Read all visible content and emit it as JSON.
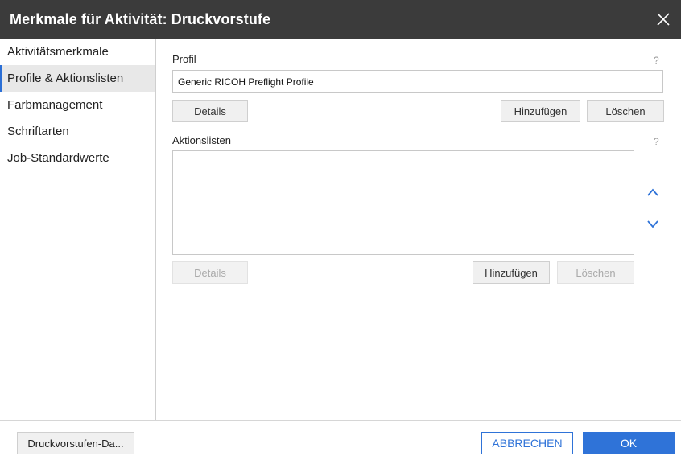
{
  "dialog": {
    "title": "Merkmale für Aktivität: Druckvorstufe"
  },
  "sidebar": {
    "items": [
      {
        "label": "Aktivitätsmerkmale",
        "active": false
      },
      {
        "label": "Profile & Aktionslisten",
        "active": true
      },
      {
        "label": "Farbmanagement",
        "active": false
      },
      {
        "label": "Schriftarten",
        "active": false
      },
      {
        "label": "Job-Standardwerte",
        "active": false
      }
    ]
  },
  "profile": {
    "label": "Profil",
    "help": "?",
    "value": "Generic RICOH Preflight Profile",
    "details_label": "Details",
    "add_label": "Hinzufügen",
    "delete_label": "Löschen"
  },
  "actionlists": {
    "label": "Aktionslisten",
    "help": "?",
    "details_label": "Details",
    "add_label": "Hinzufügen",
    "delete_label": "Löschen"
  },
  "footer": {
    "left_button_label": "Druckvorstufen-Da...",
    "cancel_label": "ABBRECHEN",
    "ok_label": "OK"
  },
  "colors": {
    "titlebar": "#3b3b3b",
    "accent": "#2f73d8"
  }
}
